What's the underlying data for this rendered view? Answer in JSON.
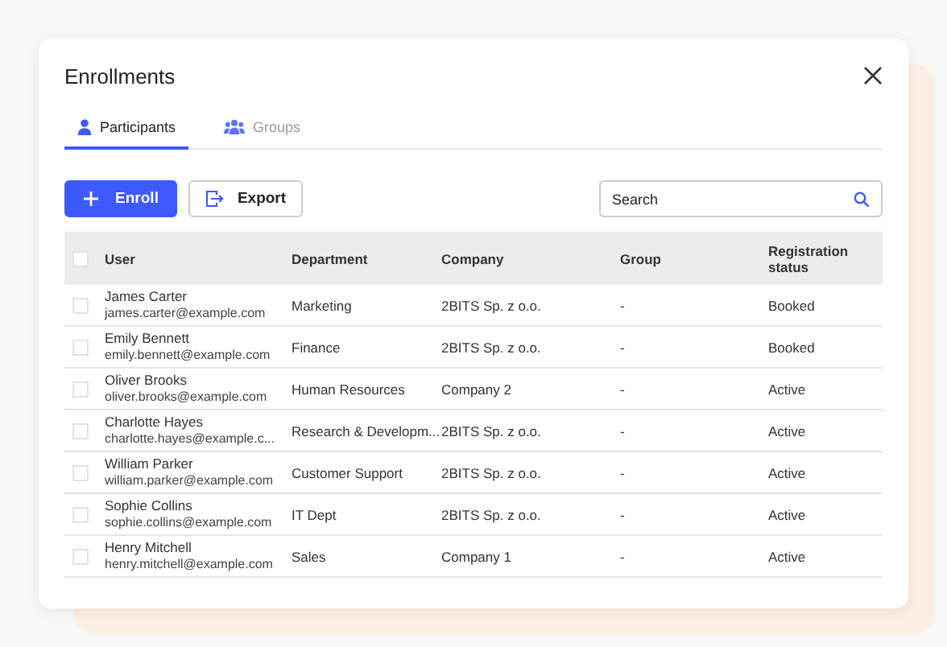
{
  "dialog": {
    "title": "Enrollments"
  },
  "tabs": [
    {
      "label": "Participants",
      "kind": "person",
      "selected": true
    },
    {
      "label": "Groups",
      "kind": "group",
      "selected": false
    }
  ],
  "toolbar": {
    "buttons": [
      {
        "label": "Enroll",
        "kind": "primary"
      },
      {
        "label": "Export",
        "kind": "secondary"
      }
    ],
    "search": {
      "placeholder": "Search"
    }
  },
  "table": {
    "all_checked": false,
    "columns": [
      "User",
      "Department",
      "Company",
      "Group",
      "Registration status"
    ],
    "rows": [
      {
        "checked": false,
        "name": "James Carter",
        "email": "james.carter@example.com",
        "department": "Marketing",
        "company": "2BITS Sp. z o.o.",
        "group": "-",
        "status": "Booked"
      },
      {
        "checked": false,
        "name": "Emily Bennett",
        "email": "emily.bennett@example.com",
        "department": "Finance",
        "company": "2BITS Sp. z o.o.",
        "group": "-",
        "status": "Booked"
      },
      {
        "checked": false,
        "name": "Oliver Brooks",
        "email": "oliver.brooks@example.com",
        "department": "Human Resources",
        "company": "Company 2",
        "group": "-",
        "status": "Active"
      },
      {
        "checked": false,
        "name": "Charlotte Hayes",
        "email": "charlotte.hayes@example.c...",
        "department": "Research & Developm...",
        "company": "2BITS Sp. z o.o.",
        "group": "-",
        "status": "Active"
      },
      {
        "checked": false,
        "name": "William Parker",
        "email": "william.parker@example.com",
        "department": "Customer Support",
        "company": "2BITS Sp. z o.o.",
        "group": "-",
        "status": "Active"
      },
      {
        "checked": false,
        "name": "Sophie Collins",
        "email": "sophie.collins@example.com",
        "department": "IT Dept",
        "company": "2BITS Sp. z o.o.",
        "group": "-",
        "status": "Active"
      },
      {
        "checked": false,
        "name": "Henry Mitchell",
        "email": "henry.mitchell@example.com",
        "department": "Sales",
        "company": "Company 1",
        "group": "-",
        "status": "Active"
      }
    ]
  }
}
